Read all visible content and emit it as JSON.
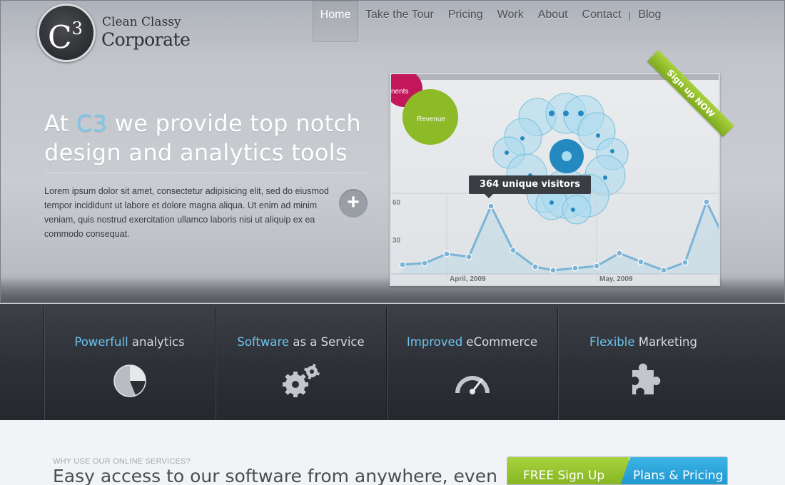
{
  "logo": {
    "mark": "C",
    "mark_sup": "3",
    "line1": "Clean Classy",
    "line2": "Corporate"
  },
  "nav": {
    "items": [
      "Home",
      "Take the Tour",
      "Pricing",
      "Work",
      "About",
      "Contact"
    ],
    "separator": "|",
    "last": "Blog"
  },
  "hero": {
    "headline_pre": "At ",
    "headline_accent": "C3",
    "headline_post1": " we provide top notch",
    "headline_post2": "design and analytics tools",
    "intro": "Lorem ipsum dolor sit amet, consectetur adipisicing elit, sed do eiusmod tempor incididunt ut labore et dolore magna aliqua. Ut enim ad minim veniam, quis nostrud exercitation ullamco laboris nisi ut aliquip ex ea commodo consequat.",
    "plus": "+"
  },
  "screenshot": {
    "ribbon": "Sign up NOW",
    "tooltip": "364 unique visitors",
    "bubble_pink": "nents",
    "bubble_green": "Revenue",
    "y_ticks": [
      "60",
      "30"
    ],
    "x_labels": [
      "April, 2009",
      "May, 2009"
    ]
  },
  "features": [
    {
      "hl": "Powerfull",
      "rest": " analytics",
      "icon": "pie-chart-icon"
    },
    {
      "hl": "Software",
      "rest": " as a Service",
      "icon": "gears-icon"
    },
    {
      "hl": "Improved",
      "rest": " eCommerce",
      "icon": "speedometer-icon"
    },
    {
      "hl": "Flexible",
      "rest": " Marketing",
      "icon": "puzzle-piece-icon"
    }
  ],
  "bottom": {
    "eyebrow": "WHY USE OUR ONLINE SERVICES?",
    "heading": "Easy access to our software from anywhere, even",
    "cta_free": "FREE Sign Up",
    "cta_plans": "Plans & Pricing"
  },
  "colors": {
    "accent_blue": "#78c8ec",
    "green": "#8cbb27",
    "dark": "#2d3036",
    "pink": "#c2185b"
  }
}
